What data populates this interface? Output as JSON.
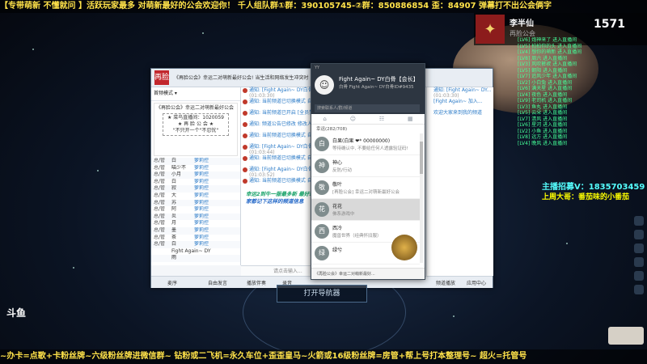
{
  "banner_top": "【专带萌新 不懂就问 】活跃玩家最多 对萌新最好的公会欢迎你！ 千人组队群①群：390105745-②群：850886854 歪：84907 弹幕打不出公会俩字",
  "streamer": {
    "name": "李半仙",
    "guild": "再脸公会",
    "counter": "1571"
  },
  "chat_overlay": [
    "[LV6] 炮神来了 进入直播间",
    "[LV5] 拍拍你的头 进入直播间",
    "[LV4] 想你的萌新 进入直播间",
    "[LV8] 周六 进入直播间",
    "[LV3] 风吹裤衩 进入直播间",
    "[LV5] 朝阳 进入直播间",
    "[LV7] 追风少年 进入直播间",
    "[LV2] 小白兔 进入直播间",
    "[LV6] 满天星 进入直播间",
    "[LV4] 夜色 进入直播间",
    "[LV9] 老司机 进入直播间",
    "[LV3] 鱼丸 进入直播间",
    "[LV5] 云朵 进入直播间",
    "[LV7] 清风 进入直播间",
    "[LV6] 星河 进入直播间",
    "[LV2] 小鱼 进入直播间",
    "[LV8] 远方 进入直播间",
    "[LV4] 晚风 进入直播间"
  ],
  "recruit": {
    "line1": "主播招募V：1835703459",
    "line2": "上周大哥：番茄味的小番茄"
  },
  "platform_logo": "斗鱼",
  "navigator_label": "打开导航器",
  "bottom_ticker": "~办卡=点歌+卡粉丝牌~六级粉丝牌进微信群~ 钻粉或二飞机=永久车位+歪歪皇马~火箭或16级粉丝牌=房管+帮上号打本整理号~ 超火=托管号",
  "client": {
    "logo": "再脸",
    "title": "《再脸公会》幸运二对萌新最好公会! 当生活和网络发生冲突时 当生活和网络发生冲突时",
    "left_toolbar": "首频模式 ▾",
    "announcement": {
      "header": "《再脸公会》幸运二对萌新最好公会",
      "lines": [
        "★ 菜鸟直播间：1020059",
        "★ 再 脸 公 会 ★",
        "\"不只开一个\"不忍忧\""
      ]
    },
    "members": [
      {
        "role": "总/管",
        "lvl": "",
        "name": "白",
        "badge": "萝莉控"
      },
      {
        "role": "总/管",
        "lvl": "",
        "name": "喵少不",
        "badge": "萝莉控"
      },
      {
        "role": "总/管",
        "lvl": "",
        "name": "小月",
        "badge": "萝莉控"
      },
      {
        "role": "总/管",
        "lvl": "",
        "name": "白",
        "badge": "萝莉控"
      },
      {
        "role": "总/管",
        "lvl": "",
        "name": "寂",
        "badge": "萝莉控"
      },
      {
        "role": "总/管",
        "lvl": "",
        "name": "大",
        "badge": "萝莉控"
      },
      {
        "role": "总/管",
        "lvl": "",
        "name": "苏",
        "badge": "萝莉控"
      },
      {
        "role": "总/管",
        "lvl": "",
        "name": "阿",
        "badge": "萝莉控"
      },
      {
        "role": "总/管",
        "lvl": "",
        "name": "炎",
        "badge": "萝莉控"
      },
      {
        "role": "总/管",
        "lvl": "",
        "name": "月",
        "badge": "萝莉控"
      },
      {
        "role": "总/管",
        "lvl": "",
        "name": "墨",
        "badge": "萝莉控"
      },
      {
        "role": "总/管",
        "lvl": "",
        "name": "茶",
        "badge": "萝莉控"
      },
      {
        "role": "总/管",
        "lvl": "",
        "name": "白",
        "badge": "萝莉控"
      },
      {
        "role": "",
        "lvl": "",
        "name": "Fight Again~ DY",
        "badge": ""
      },
      {
        "role": "",
        "lvl": "",
        "name": "雨",
        "badge": ""
      }
    ],
    "messages": [
      {
        "from": "通知: [Fight Again~ DY白骨... ",
        "time": "(01:03:30)"
      },
      {
        "from": "通知: 当前频道已切换模式 自由发言",
        "time": ""
      },
      {
        "from": "通知: 当前频道已开启 [全员禁言]",
        "time": ""
      },
      {
        "from": "通知: 频道公告已修改 修改人...",
        "time": ""
      },
      {
        "from": "通知: 当前频道已切换模式 自由发言",
        "time": ""
      },
      {
        "from": "通知: [Fight Again~ DY白骨...",
        "time": "(01:03:44)"
      },
      {
        "from": "通知: 当前频道已切换模式 自由发言",
        "time": ""
      },
      {
        "from": "通知: [Fight Again~ DY白骨...",
        "time": "(01:03:52)"
      },
      {
        "from": "通知: 当前频道已切换模式 自由发言",
        "time": ""
      }
    ],
    "highlight": {
      "green": "幸运2到牛一服最多新 最好玩 萌新来了都是家人 有事情找我们",
      "blue": "在大家都记下这样的频道信息"
    },
    "input_placeholder": "请点击输入...",
    "footer": [
      "麦序",
      "自由发言",
      "播放伴奏",
      "录音"
    ],
    "right_messages": [
      {
        "from": "通知: [Fight Again~ DY...",
        "time": "(01:03:30)"
      },
      {
        "from": "[Fight Again~ 加入...",
        "time": ""
      },
      {
        "from": "欢迎大家来到我的频道",
        "time": ""
      }
    ],
    "right_footer": [
      "频道播放",
      "应用中心"
    ]
  },
  "popup": {
    "top_label": "YY",
    "name": "Fight Again~ DY白骨【会长】",
    "sub": "白骨 Fight Again~ DY白骨ID#9435",
    "search_placeholder": "搜索联系人/群/频道",
    "group_label": "幸运(282/708)",
    "contacts": [
      {
        "name": "白果(白果 ❤* 00000000)",
        "status": "等待确认中, 不要给任何人透露验证码!"
      },
      {
        "name": "神心",
        "status": "反防/行动"
      },
      {
        "name": "敬叶",
        "status": "[再脸公会] 幸运二对萌新最好公会"
      },
      {
        "name": "花花",
        "status": "佛系游戏中"
      },
      {
        "name": "西冷",
        "status": "魔兽世界（经典怀旧服）"
      },
      {
        "name": "绿兮",
        "status": ""
      }
    ],
    "footer_text": "《再脸公会》幸运二对萌新最好..."
  }
}
